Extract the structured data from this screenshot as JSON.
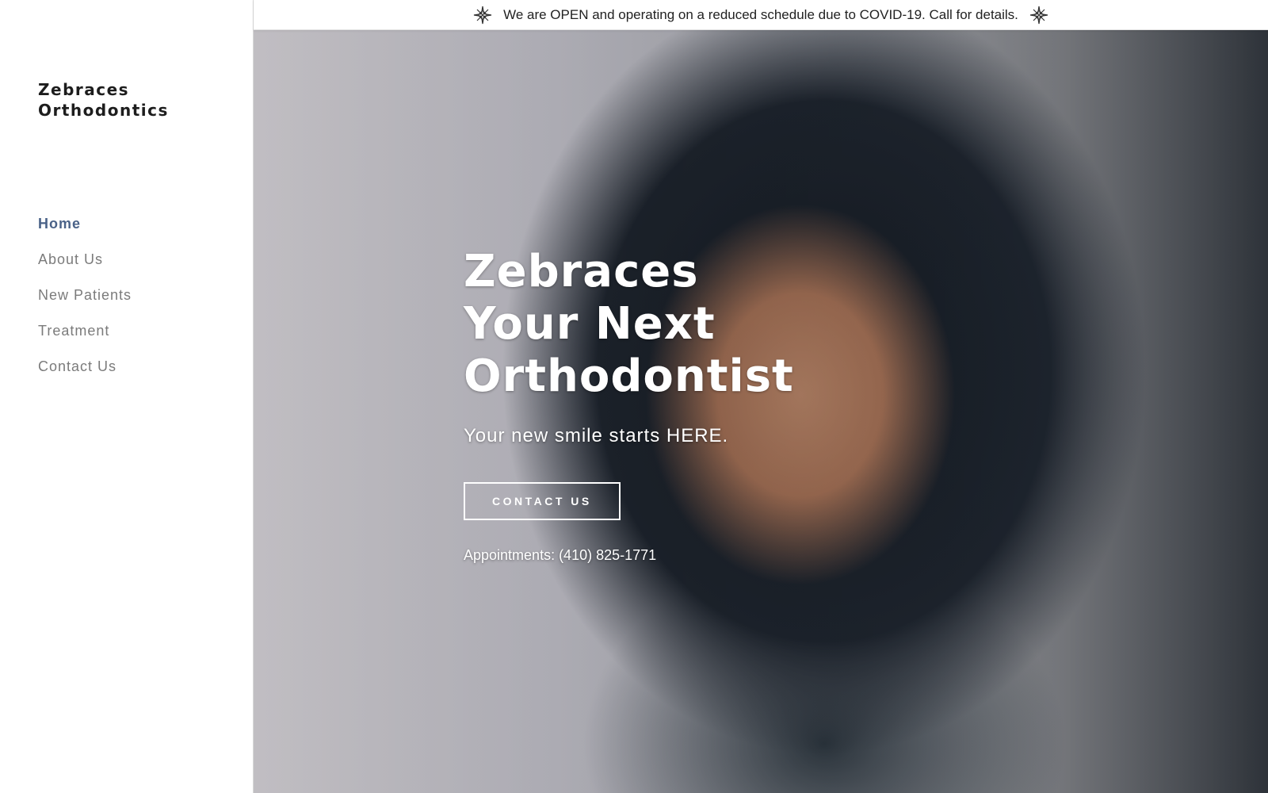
{
  "site": {
    "logo": "Zebraces Orthodontics"
  },
  "nav": {
    "items": [
      {
        "label": "Home",
        "active": true
      },
      {
        "label": "About Us",
        "active": false
      },
      {
        "label": "New Patients",
        "active": false
      },
      {
        "label": "Treatment",
        "active": false
      },
      {
        "label": "Contact Us",
        "active": false
      }
    ]
  },
  "announcement": {
    "text": "We are OPEN and operating on a reduced schedule due to COVID-19. Call for details.",
    "icon": "compass-star-icon"
  },
  "hero": {
    "title_lines": [
      "Zebraces",
      "Your Next",
      "Orthodontist"
    ],
    "subtitle": "Your new smile starts HERE.",
    "button_label": "CONTACT US",
    "phone_text": "Appointments: (410) 825-1771",
    "image": "woman-smiling-with-braces"
  },
  "colors": {
    "nav_active": "#4a6288",
    "nav_inactive": "#7b7b7b",
    "text_dark": "#1d1d1d"
  }
}
